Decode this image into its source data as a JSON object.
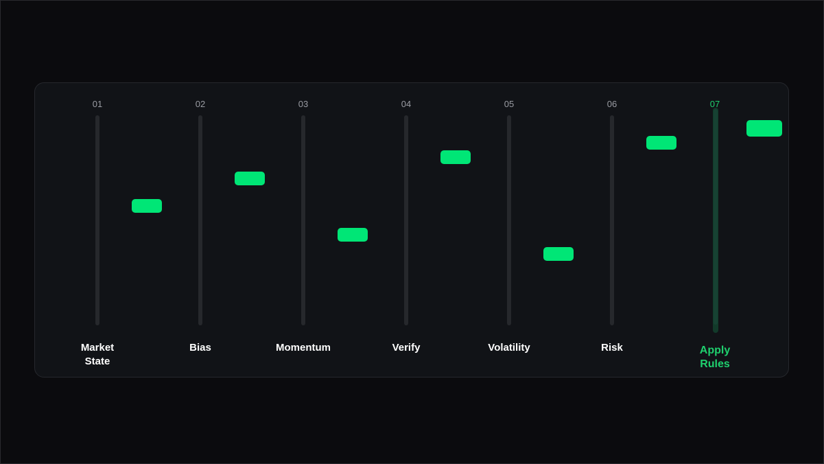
{
  "sliders": [
    {
      "number": "01",
      "label_lines": [
        "Market",
        "State"
      ],
      "value": 0.57
    },
    {
      "number": "02",
      "label_lines": [
        "Bias"
      ],
      "value": 0.7
    },
    {
      "number": "03",
      "label_lines": [
        "Momentum"
      ],
      "value": 0.43
    },
    {
      "number": "04",
      "label_lines": [
        "Verify"
      ],
      "value": 0.8
    },
    {
      "number": "05",
      "label_lines": [
        "Volatility"
      ],
      "value": 0.34
    },
    {
      "number": "06",
      "label_lines": [
        "Risk"
      ],
      "value": 0.87
    },
    {
      "number": "07",
      "label_lines": [
        "Apply",
        "Rules"
      ],
      "value": 0.91,
      "active": true
    }
  ],
  "colors": {
    "accent": "#00e676",
    "active_text": "#1fd06e",
    "background": "#0b0b0e",
    "panel": "#111317",
    "track": "#26282c"
  }
}
